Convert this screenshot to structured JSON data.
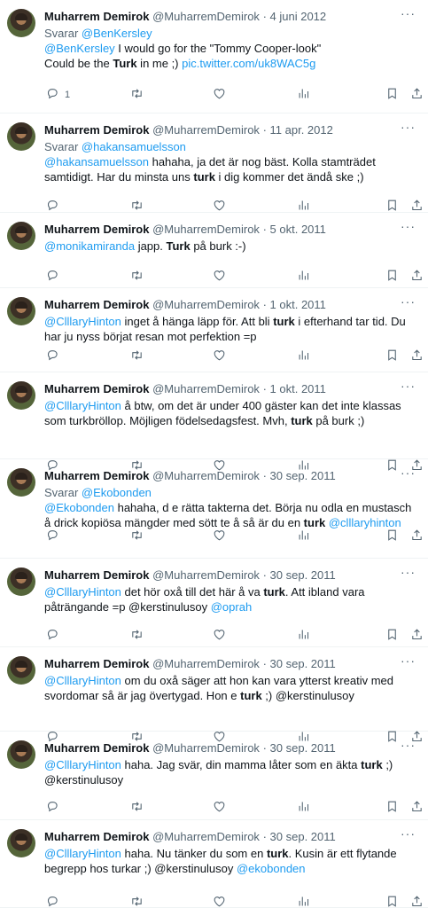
{
  "author": {
    "name": "Muharrem Demirok",
    "handle": "@MuharremDemirok"
  },
  "separator": "·",
  "more_glyph": "···",
  "replying_label": "Svarar",
  "tweets": [
    {
      "date": "4 juni 2012",
      "reply_to": "@BenKersley",
      "segments": [
        {
          "t": "link",
          "v": "@BenKersley"
        },
        {
          "t": "text",
          "v": " I would go for the \"Tommy Cooper-look\""
        },
        {
          "t": "br"
        },
        {
          "t": "text",
          "v": "Could be the "
        },
        {
          "t": "kw",
          "v": "Turk"
        },
        {
          "t": "text",
          "v": " in me ;) "
        },
        {
          "t": "link",
          "v": "pic.twitter.com/uk8WAC5g"
        }
      ],
      "reply_count": "1"
    },
    {
      "date": "11 apr. 2012",
      "reply_to": "@hakansamuelsson",
      "segments": [
        {
          "t": "link",
          "v": "@hakansamuelsson"
        },
        {
          "t": "text",
          "v": " hahaha, ja det är nog bäst. Kolla stamträdet samtidigt. Har du minsta uns "
        },
        {
          "t": "kw",
          "v": "turk"
        },
        {
          "t": "text",
          "v": " i dig kommer det ändå ske ;)"
        }
      ],
      "reply_count": ""
    },
    {
      "date": "5 okt. 2011",
      "reply_to": "",
      "segments": [
        {
          "t": "link",
          "v": "@monikamiranda"
        },
        {
          "t": "text",
          "v": " japp. "
        },
        {
          "t": "kw",
          "v": "Turk"
        },
        {
          "t": "text",
          "v": " på burk :-)"
        }
      ],
      "reply_count": ""
    },
    {
      "date": "1 okt. 2011",
      "reply_to": "",
      "segments": [
        {
          "t": "link",
          "v": "@ClllaryHinton"
        },
        {
          "t": "text",
          "v": " inget å hänga läpp för. Att bli "
        },
        {
          "t": "kw",
          "v": "turk"
        },
        {
          "t": "text",
          "v": " i efterhand tar tid. Du har ju nyss börjat resan mot perfektion =p"
        }
      ],
      "reply_count": ""
    },
    {
      "date": "1 okt. 2011",
      "reply_to": "",
      "segments": [
        {
          "t": "link",
          "v": "@ClllaryHinton"
        },
        {
          "t": "text",
          "v": " å btw, om det är under 400 gäster kan det inte klassas som turkbröllop. Möjligen födelsedagsfest. Mvh, "
        },
        {
          "t": "kw",
          "v": "turk"
        },
        {
          "t": "text",
          "v": " på burk ;)"
        }
      ],
      "reply_count": ""
    },
    {
      "date": "30 sep. 2011",
      "reply_to": "@Ekobonden",
      "segments": [
        {
          "t": "link",
          "v": "@Ekobonden"
        },
        {
          "t": "text",
          "v": " hahaha, d e rätta takterna det. Börja nu odla en mustasch å drick kopiösa mängder med sött te å så är du en "
        },
        {
          "t": "kw",
          "v": "turk"
        },
        {
          "t": "text",
          "v": " "
        },
        {
          "t": "link",
          "v": "@clllaryhinton"
        }
      ],
      "reply_count": ""
    },
    {
      "date": "30 sep. 2011",
      "reply_to": "",
      "segments": [
        {
          "t": "link",
          "v": "@ClllaryHinton"
        },
        {
          "t": "text",
          "v": " det hör oxå till det här å va "
        },
        {
          "t": "kw",
          "v": "turk"
        },
        {
          "t": "text",
          "v": ". Att ibland vara påträngande =p @kerstinulusoy "
        },
        {
          "t": "link",
          "v": "@oprah"
        }
      ],
      "reply_count": ""
    },
    {
      "date": "30 sep. 2011",
      "reply_to": "",
      "segments": [
        {
          "t": "link",
          "v": "@ClllaryHinton"
        },
        {
          "t": "text",
          "v": " om du oxå säger att hon kan vara ytterst kreativ med svordomar så är jag övertygad. Hon e "
        },
        {
          "t": "kw",
          "v": "turk"
        },
        {
          "t": "text",
          "v": " ;) @kerstinulusoy"
        }
      ],
      "reply_count": ""
    },
    {
      "date": "30 sep. 2011",
      "reply_to": "",
      "segments": [
        {
          "t": "link",
          "v": "@ClllaryHinton"
        },
        {
          "t": "text",
          "v": " haha. Jag svär, din mamma låter som en äkta "
        },
        {
          "t": "kw",
          "v": "turk"
        },
        {
          "t": "text",
          "v": " ;) @kerstinulusoy"
        }
      ],
      "reply_count": ""
    },
    {
      "date": "30 sep. 2011",
      "reply_to": "",
      "segments": [
        {
          "t": "link",
          "v": "@ClllaryHinton"
        },
        {
          "t": "text",
          "v": " haha. Nu tänker du som en "
        },
        {
          "t": "kw",
          "v": "turk"
        },
        {
          "t": "text",
          "v": ". Kusin är ett flytande begrepp hos turkar ;) @kerstinulusoy "
        },
        {
          "t": "link",
          "v": "@ekobonden"
        }
      ],
      "reply_count": ""
    }
  ]
}
